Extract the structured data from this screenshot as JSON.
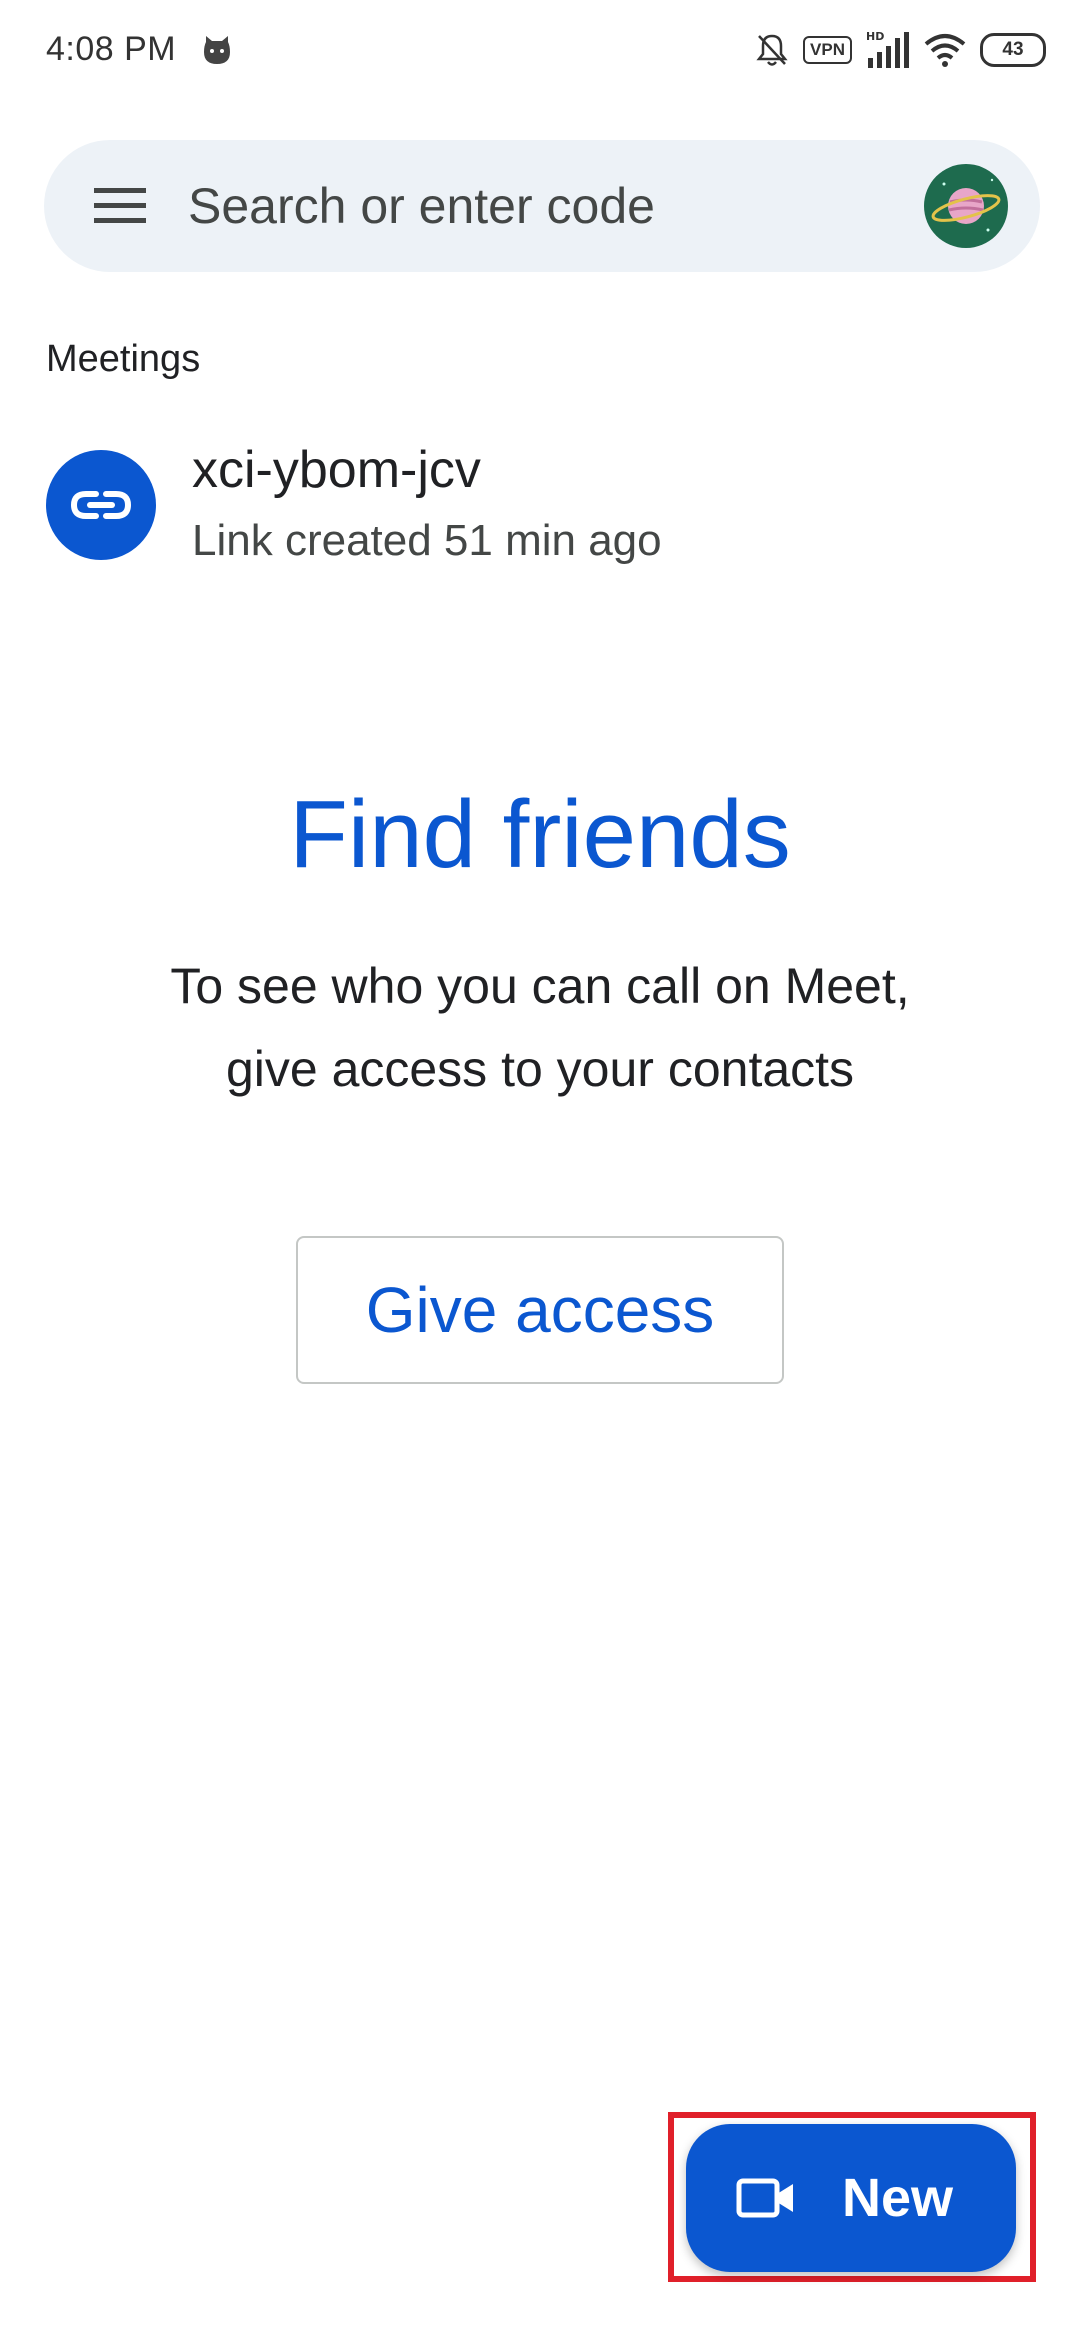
{
  "status_bar": {
    "time": "4:08 PM",
    "vpn_label": "VPN",
    "network_label": "HD",
    "battery_level": "43",
    "icons": [
      "cat-icon",
      "bell-muted-icon",
      "vpn-icon",
      "signal-icon",
      "wifi-icon",
      "battery-icon"
    ]
  },
  "search": {
    "placeholder": "Search or enter code",
    "menu_icon": "hamburger-menu-icon",
    "avatar_icon": "planet-avatar"
  },
  "meetings": {
    "section_label": "Meetings",
    "items": [
      {
        "code": "xci-ybom-jcv",
        "subtitle": "Link created 51 min ago",
        "icon": "link-icon"
      }
    ]
  },
  "find_friends": {
    "title": "Find friends",
    "description": "To see who you can call on Meet, give access to your contacts",
    "button_label": "Give access"
  },
  "fab": {
    "label": "New",
    "icon": "video-camera-icon"
  },
  "colors": {
    "accent": "#0b57d0",
    "search_bg": "#edf2f7",
    "highlight": "#e0202a"
  }
}
